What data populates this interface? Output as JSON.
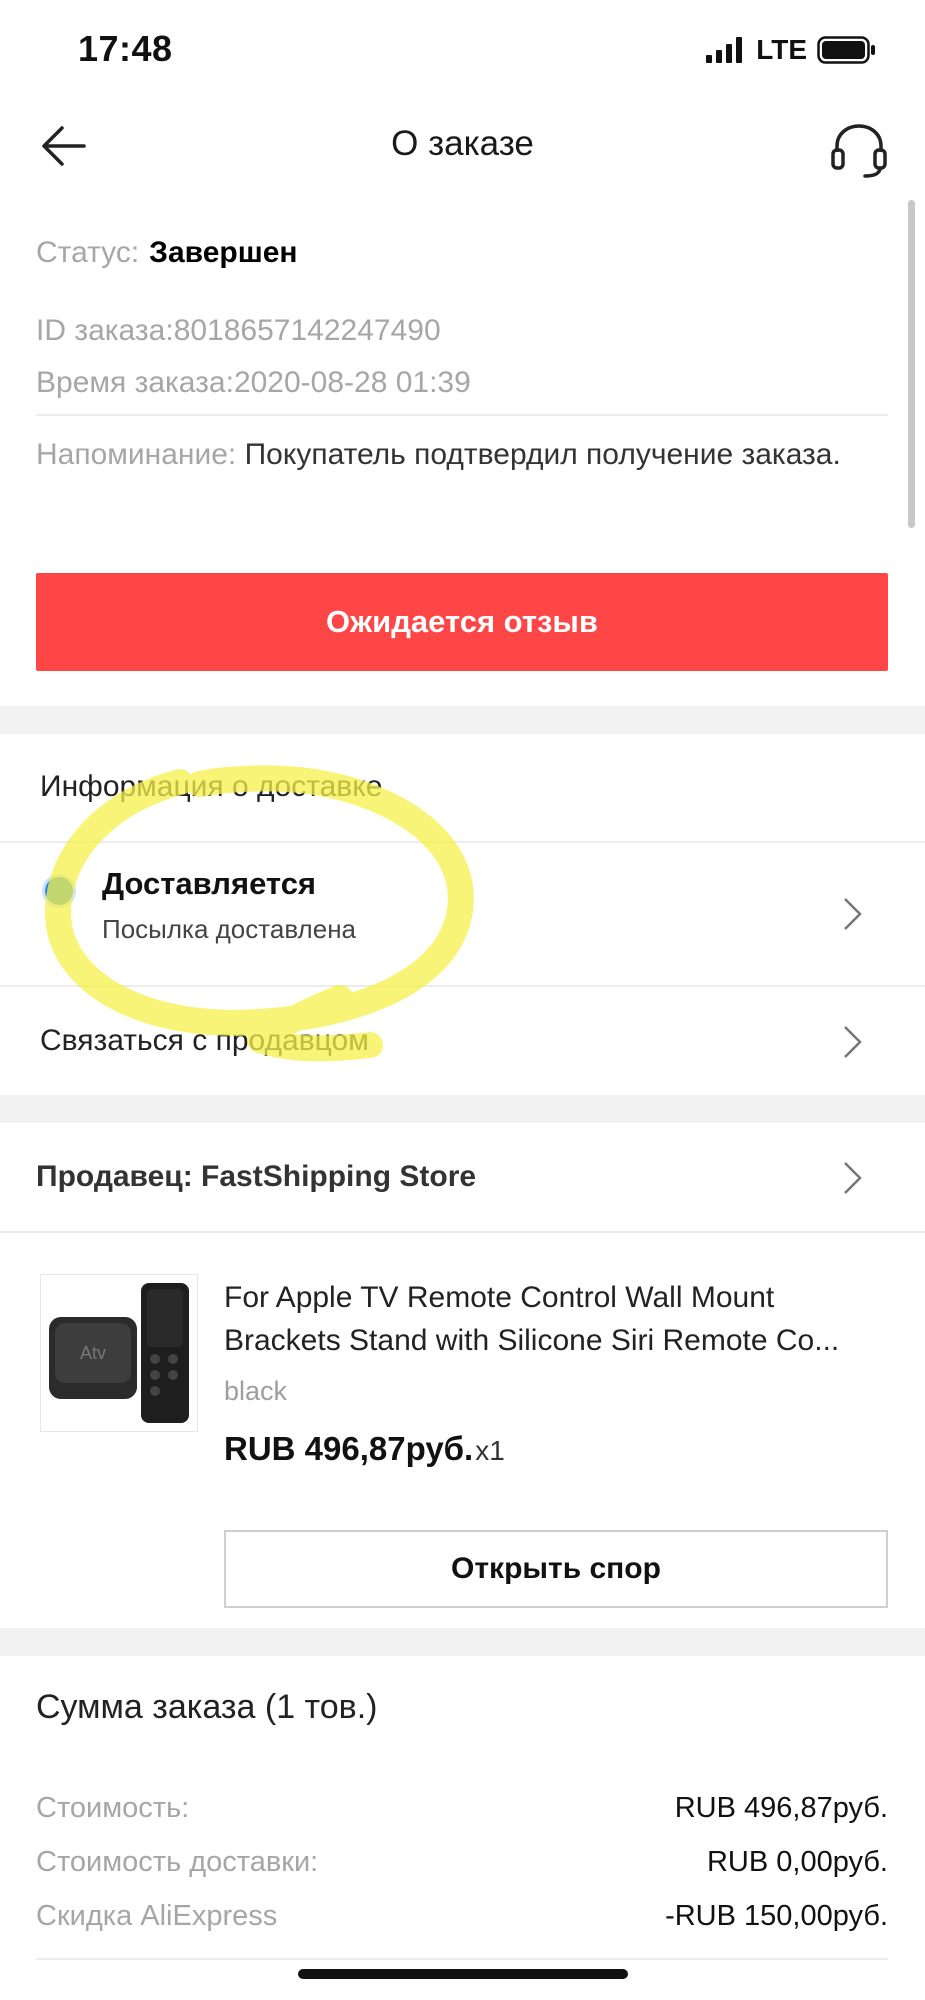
{
  "status_bar": {
    "time": "17:48",
    "network": "LTE"
  },
  "nav": {
    "title": "О заказе",
    "back_icon": "arrow-left-icon",
    "support_icon": "headset-icon"
  },
  "order": {
    "status_label": "Статус:",
    "status_value": "Завершен",
    "id_label": "ID заказа:",
    "id_value": "8018657142247490",
    "time_label": "Время заказа:",
    "time_value": "2020-08-28 01:39",
    "reminder_label": "Напоминание:",
    "reminder_text": "Покупатель подтвердил получение заказа.",
    "review_button": "Ожидается отзыв"
  },
  "delivery": {
    "section_title": "Информация о доставке",
    "state_title": "Доставляется",
    "state_sub": "Посылка доставлена",
    "contact_seller": "Связаться с продавцом"
  },
  "seller": {
    "label": "Продавец: FastShipping Store"
  },
  "product": {
    "title": "For Apple TV Remote Control Wall Mount Brackets Stand with Silicone Siri Remote Co...",
    "variant": "black",
    "price": "RUB 496,87руб.",
    "qty": "x1",
    "image_label": "Atv",
    "dispute_button": "Открыть спор"
  },
  "summary": {
    "title": "Сумма заказа (1 тов.)",
    "rows": [
      {
        "label": "Стоимость:",
        "value": "RUB 496,87руб."
      },
      {
        "label": "Стоимость доставки:",
        "value": "RUB 0,00руб."
      },
      {
        "label": "Скидка AliExpress",
        "value": "-RUB 150,00руб."
      }
    ]
  },
  "colors": {
    "accent": "#fe4646",
    "highlight": "#f5f04a",
    "delivery_dot": "#2f8be8"
  }
}
